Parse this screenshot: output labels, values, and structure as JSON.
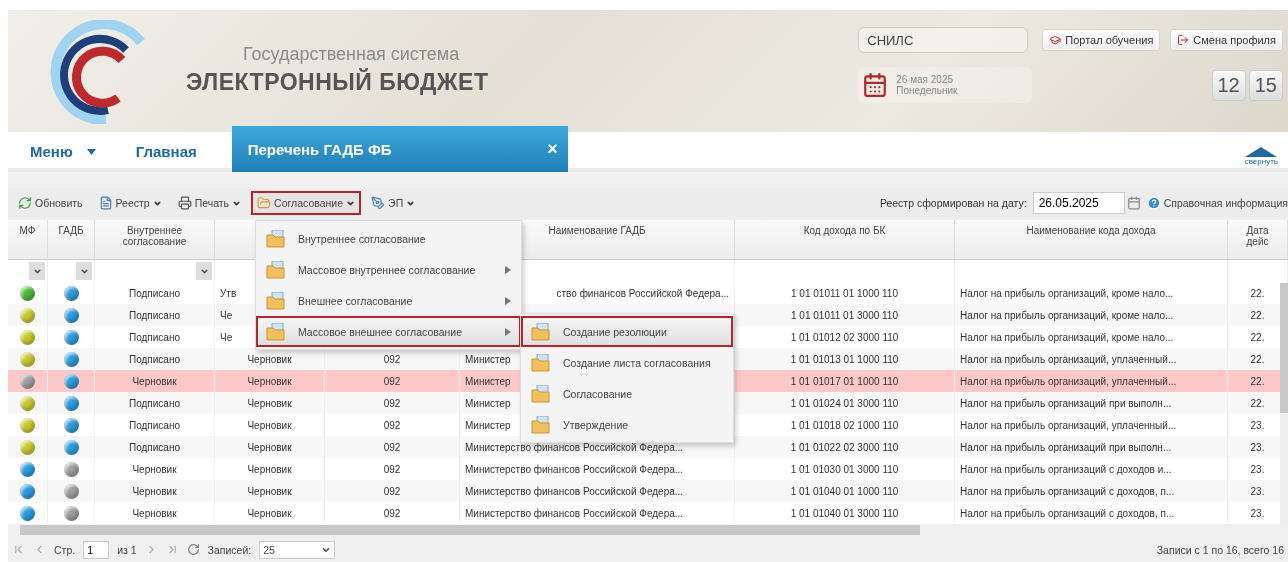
{
  "header": {
    "subtitle": "Государственная система",
    "title": "ЭЛЕКТРОННЫЙ БЮДЖЕТ",
    "snils": {
      "placeholder": "СНИЛС"
    },
    "buttons": [
      {
        "label": "Портал обучения",
        "kind": "learning"
      },
      {
        "label": "Смена профиля",
        "kind": "switch"
      }
    ],
    "date": "26 мая 2025",
    "weekday": "Понедельник",
    "clock": {
      "hours": "12",
      "minutes": "15"
    }
  },
  "nav": {
    "menu": "Меню",
    "home": "Главная",
    "tab": {
      "label": "Перечень ГАДБ ФБ",
      "close": "×"
    },
    "collapse": "свернуть"
  },
  "toolbar": {
    "items": [
      {
        "label": "Обновить",
        "kind": "refresh",
        "dropdown": false,
        "selected": false
      },
      {
        "label": "Реестр",
        "kind": "registry",
        "dropdown": true,
        "selected": false
      },
      {
        "label": "Печать",
        "kind": "print",
        "dropdown": true,
        "selected": false
      },
      {
        "label": "Согласование",
        "kind": "approval",
        "dropdown": true,
        "selected": true
      },
      {
        "label": "ЭП",
        "kind": "signature",
        "dropdown": true,
        "selected": false
      }
    ],
    "date_label": "Реестр сформирован на дату:",
    "date_value": "26.05.2025",
    "help": "Справочная информация"
  },
  "menu": {
    "items": [
      {
        "label": "Внутреннее согласование",
        "submenu": false,
        "selected": false
      },
      {
        "label": "Массовое внутреннее согласование",
        "submenu": true,
        "selected": false
      },
      {
        "label": "Внешнее согласование",
        "submenu": true,
        "selected": false
      },
      {
        "label": "Массовое внешнее согласование",
        "submenu": true,
        "selected": true
      }
    ]
  },
  "submenu": {
    "items": [
      {
        "label": "Создание резолюции",
        "selected": true
      },
      {
        "label": "Создание листа согласования",
        "selected": false
      },
      {
        "label": "Согласование",
        "selected": false
      },
      {
        "label": "Утверждение",
        "selected": false
      }
    ]
  },
  "table": {
    "columns": [
      {
        "label": "МФ"
      },
      {
        "label": "ГАДБ"
      },
      {
        "label": "Внутреннее согласование"
      },
      null,
      null,
      {
        "label": "Наименование ГАДБ"
      },
      {
        "label": "Код дохода по БК"
      },
      {
        "label": "Наименование кода дохода"
      },
      {
        "label": "Дата\nдейс"
      }
    ],
    "rows": [
      {
        "selected": false,
        "cells": [
          {
            "color": "#4cb83a"
          },
          {
            "color": "#2a9de0"
          },
          "Подписано",
          {
            "text": "Утв",
            "kind": "head"
          },
          null,
          {
            "text": "ство финансов Российской Федера...",
            "kind": "tail"
          },
          "1 01 01011 01 1000 110",
          "Налог на прибыль организаций, кроме нало...",
          "22."
        ]
      },
      {
        "selected": false,
        "cells": [
          {
            "color": "#c9cc2c"
          },
          {
            "color": "#2a9de0"
          },
          "Подписано",
          {
            "text": "Че",
            "kind": "head"
          },
          null,
          null,
          "1 01 01011 01 3000 110",
          "Налог на прибыль организаций, кроме нало...",
          "22."
        ]
      },
      {
        "selected": false,
        "cells": [
          {
            "color": "#c9cc2c"
          },
          {
            "color": "#2a9de0"
          },
          "Подписано",
          {
            "text": "Че",
            "kind": "head"
          },
          null,
          null,
          "1 01 01012 02 3000 110",
          "Налог на прибыль организаций, кроме нало...",
          "22."
        ]
      },
      {
        "selected": false,
        "cells": [
          {
            "color": "#c9cc2c"
          },
          {
            "color": "#2a9de0"
          },
          "Подписано",
          "Черновик",
          "092",
          "Министер",
          "1 01 01013 01 1000 110",
          "Налог на прибыль организаций, уплаченный...",
          "22."
        ]
      },
      {
        "selected": true,
        "cells": [
          {
            "color": "#a0a0a0"
          },
          {
            "color": "#2a9de0"
          },
          "Черновик",
          "Черновик",
          "092",
          "Министер",
          "1 01 01017 01 1000 110",
          "Налог на прибыль организаций, уплаченный...",
          "22."
        ]
      },
      {
        "selected": false,
        "cells": [
          {
            "color": "#c9cc2c"
          },
          {
            "color": "#2a9de0"
          },
          "Подписано",
          "Черновик",
          "092",
          "Министер",
          "1 01 01024 01 3000 110",
          "Налог на прибыль организаций при выполн...",
          "22."
        ]
      },
      {
        "selected": false,
        "cells": [
          {
            "color": "#c9cc2c"
          },
          {
            "color": "#2a9de0"
          },
          "Подписано",
          "Черновик",
          "092",
          "Министер",
          "1 01 01018 02 1000 110",
          "Налог на прибыль организаций, уплаченный...",
          "23."
        ]
      },
      {
        "selected": false,
        "cells": [
          {
            "color": "#c9cc2c"
          },
          {
            "color": "#2a9de0"
          },
          "Подписано",
          "Черновик",
          "092",
          "Министерство финансов Российской Федера...",
          "1 01 01022 02 3000 110",
          "Налог на прибыль организаций при выполн...",
          "23."
        ]
      },
      {
        "selected": false,
        "cells": [
          {
            "color": "#2a9de0"
          },
          {
            "color": "#a0a0a0"
          },
          "Черновик",
          "Черновик",
          "092",
          "Министерство финансов Российской Федера...",
          "1 01 01030 01 3000 110",
          "Налог на прибыль организаций с доходов и...",
          "23."
        ]
      },
      {
        "selected": false,
        "cells": [
          {
            "color": "#2a9de0"
          },
          {
            "color": "#a0a0a0"
          },
          "Черновик",
          "Черновик",
          "092",
          "Министерство финансов Российской Федера...",
          "1 01 01040 01 1000 110",
          "Налог на прибыль организаций с доходов, п...",
          "23."
        ]
      },
      {
        "selected": false,
        "cells": [
          {
            "color": "#2a9de0"
          },
          {
            "color": "#a0a0a0"
          },
          "Черновик",
          "Черновик",
          "092",
          "Министерство финансов Российской Федера...",
          "1 01 01040 01 3000 110",
          "Налог на прибыль организаций с доходов, п...",
          "23."
        ]
      }
    ]
  },
  "pager": {
    "page_label": "Стр.",
    "page": "1",
    "of": "из 1",
    "per_page_label": "Записей:",
    "per_page": "25",
    "summary": "Записи с 1 по 16, всего 16"
  }
}
